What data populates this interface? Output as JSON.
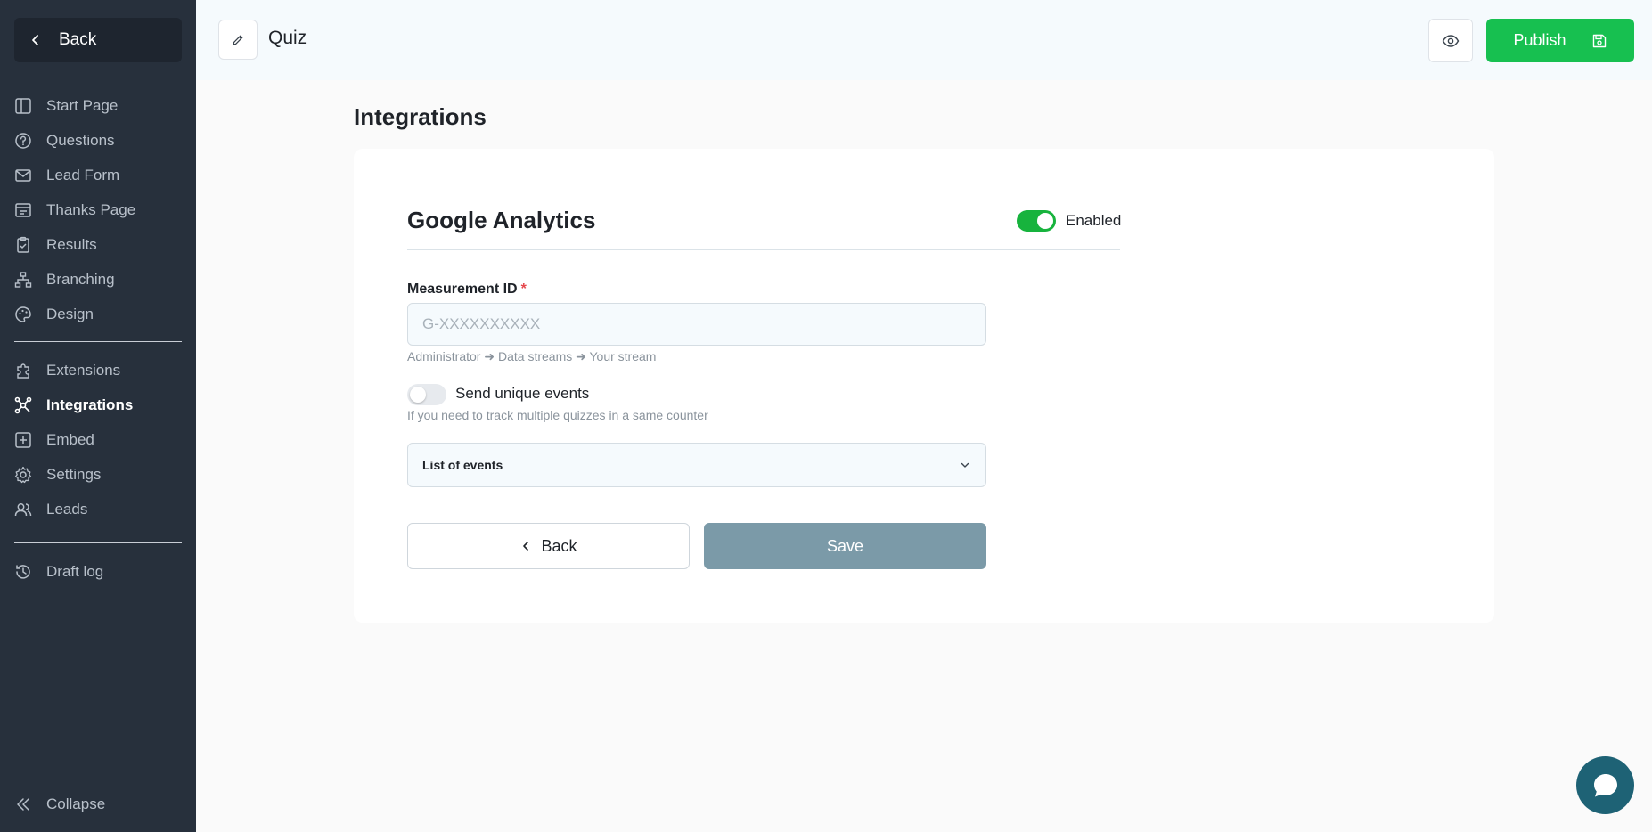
{
  "sidebar": {
    "back_label": "Back",
    "items": [
      {
        "label": "Start Page",
        "icon": "layout-icon"
      },
      {
        "label": "Questions",
        "icon": "question-circle-icon"
      },
      {
        "label": "Lead Form",
        "icon": "mail-icon"
      },
      {
        "label": "Thanks Page",
        "icon": "card-icon"
      },
      {
        "label": "Results",
        "icon": "clipboard-icon"
      },
      {
        "label": "Branching",
        "icon": "branch-icon"
      },
      {
        "label": "Design",
        "icon": "palette-icon"
      }
    ],
    "items2": [
      {
        "label": "Extensions",
        "icon": "puzzle-icon"
      },
      {
        "label": "Integrations",
        "icon": "integrations-icon",
        "active": true
      },
      {
        "label": "Embed",
        "icon": "plus-square-icon"
      },
      {
        "label": "Settings",
        "icon": "gear-icon"
      },
      {
        "label": "Leads",
        "icon": "users-icon"
      }
    ],
    "items3": [
      {
        "label": "Draft log",
        "icon": "history-icon"
      }
    ],
    "collapse_label": "Collapse"
  },
  "header": {
    "title": "Quiz",
    "publish_label": "Publish"
  },
  "main": {
    "page_title": "Integrations",
    "ga": {
      "title": "Google Analytics",
      "enabled_label": "Enabled",
      "enabled": true,
      "measurement_label": "Measurement ID",
      "required_mark": "*",
      "measurement_value": "",
      "measurement_placeholder": "G-XXXXXXXXXX",
      "measurement_hint": "Administrator ➜ Data streams ➜ Your stream",
      "unique_label": "Send unique events",
      "unique_enabled": false,
      "unique_hint": "If you need to track multiple quizzes in a same counter",
      "events_label": "List of events",
      "back_label": "Back",
      "save_label": "Save"
    }
  },
  "colors": {
    "sidebar_bg": "#27303c",
    "accent_green": "#17c050",
    "save_disabled": "#7b9aa8",
    "chat_bg": "#1e6275"
  }
}
